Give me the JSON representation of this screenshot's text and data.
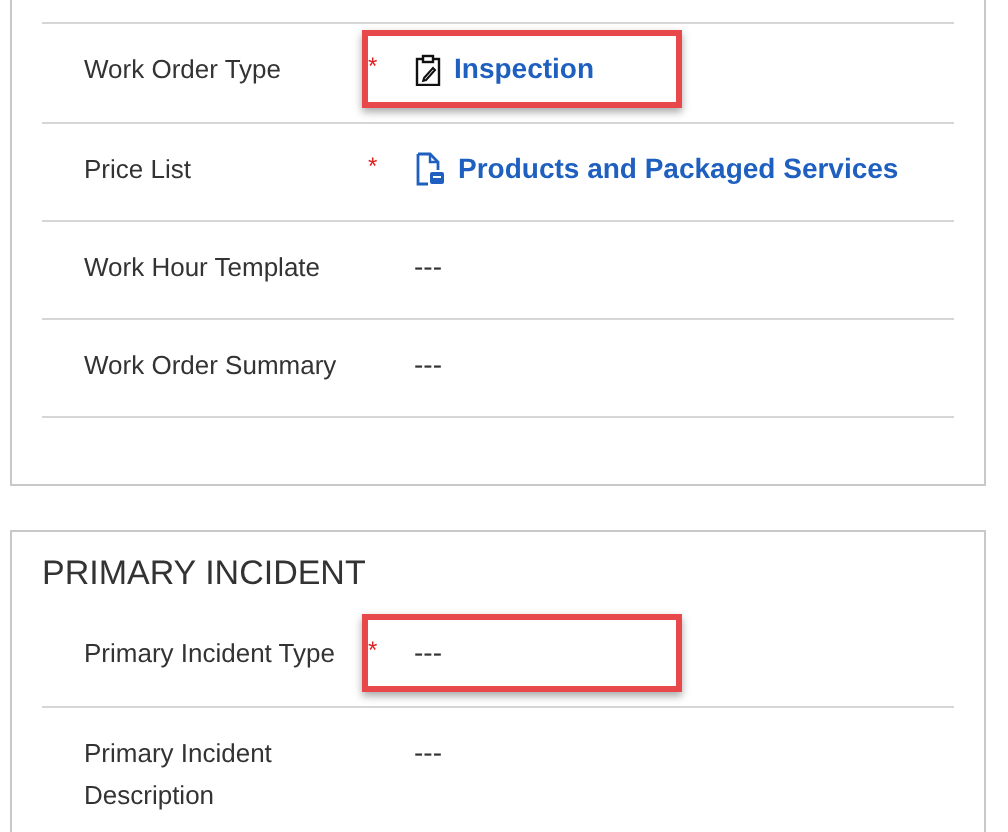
{
  "sections": [
    {
      "fields": [
        {
          "label": "Work Order Type",
          "required_mark": "*",
          "highlighted": true,
          "kind": "lookup",
          "value": "Inspection"
        },
        {
          "label": "Price List",
          "required_mark": "*",
          "highlighted": false,
          "kind": "lookup",
          "value": "Products and Packaged Services"
        },
        {
          "label": "Work Hour Template",
          "highlighted": false,
          "kind": "text",
          "value": "---"
        },
        {
          "label": "Work Order Summary",
          "highlighted": false,
          "kind": "text",
          "value": "---"
        }
      ]
    },
    {
      "title": "PRIMARY INCIDENT",
      "fields": [
        {
          "label": "Primary Incident Type",
          "required_mark": "*",
          "highlighted": true,
          "kind": "text",
          "value": "---"
        },
        {
          "label": "Primary Incident Description",
          "highlighted": false,
          "kind": "text",
          "value": "---"
        }
      ]
    }
  ]
}
